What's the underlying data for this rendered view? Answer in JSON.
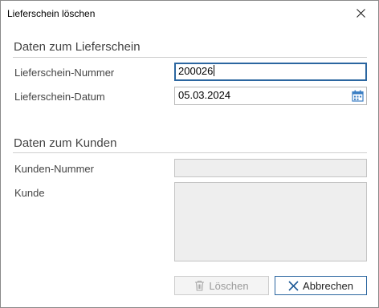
{
  "window": {
    "title": "Lieferschein löschen"
  },
  "section_delivery": {
    "title": "Daten zum Lieferschein",
    "number_label": "Lieferschein-Nummer",
    "number_value": "200026",
    "date_label": "Lieferschein-Datum",
    "date_value": "05.03.2024"
  },
  "section_customer": {
    "title": "Daten zum Kunden",
    "customer_number_label": "Kunden-Nummer",
    "customer_number_value": "",
    "customer_label": "Kunde",
    "customer_value": ""
  },
  "buttons": {
    "delete_label": "Löschen",
    "cancel_label": "Abbrechen"
  },
  "icons": {
    "close": "close-icon",
    "calendar": "calendar-icon",
    "trash": "trash-icon",
    "cancel": "x-icon"
  },
  "colors": {
    "accent": "#2b66a0",
    "calendar_icon": "#3c7fc4"
  }
}
